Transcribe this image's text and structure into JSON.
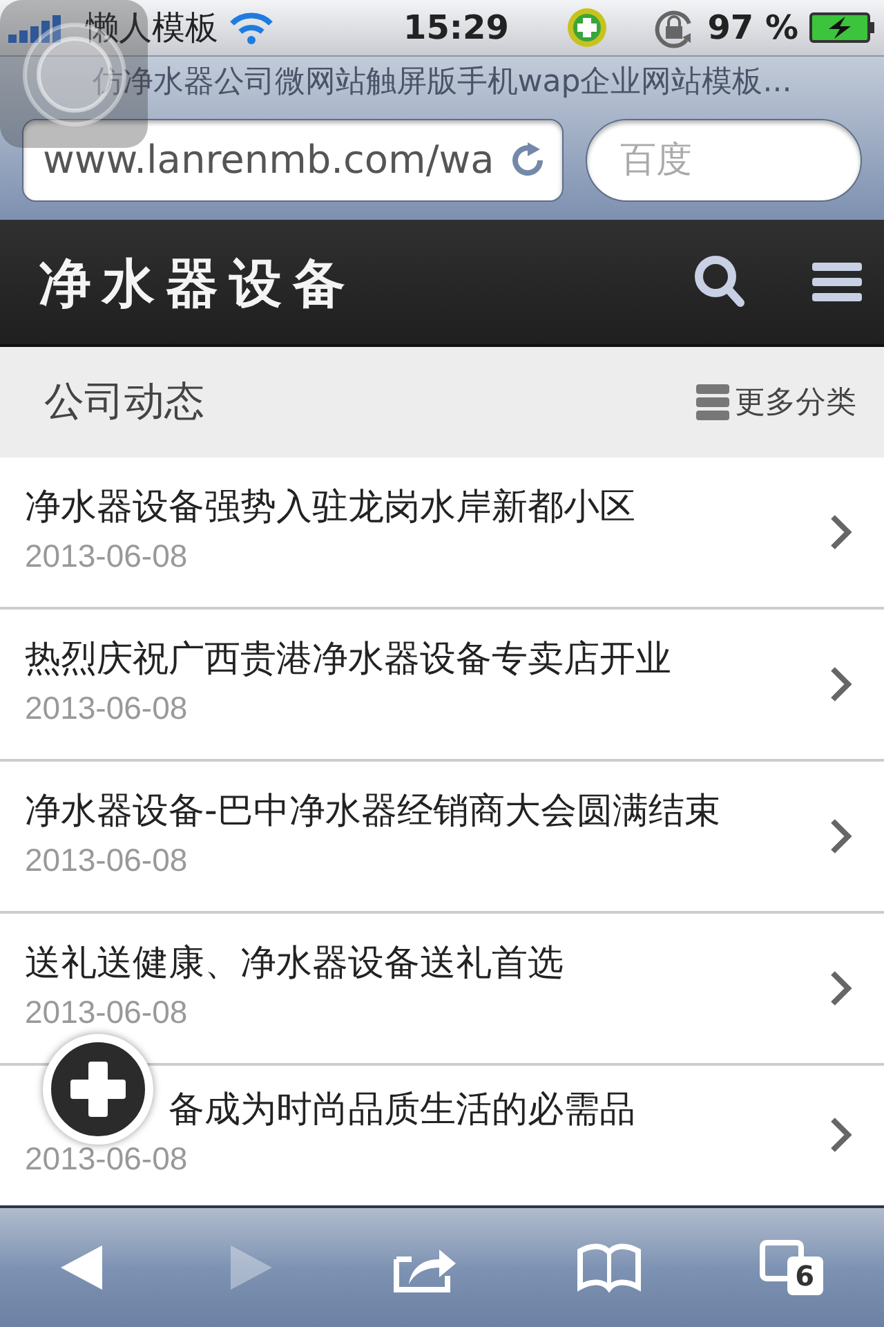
{
  "status_bar": {
    "carrier": "懒人模板",
    "time": "15:29",
    "battery": "97 %"
  },
  "browser": {
    "page_title": "仿净水器公司微网站触屏版手机wap企业网站模板...",
    "url": "www.lanrenmb.com/wa",
    "search": {
      "placeholder": "百度"
    }
  },
  "header": {
    "logo": "净水器设备"
  },
  "section": {
    "title": "公司动态",
    "more": "更多分类"
  },
  "news": [
    {
      "title": "净水器设备强势入驻龙岗水岸新都小区",
      "date": "2013-06-08"
    },
    {
      "title": "热烈庆祝广西贵港净水器设备专卖店开业",
      "date": "2013-06-08"
    },
    {
      "title": "净水器设备-巴中净水器经销商大会圆满结束",
      "date": "2013-06-08"
    },
    {
      "title": "送礼送健康、净水器设备送礼首选",
      "date": "2013-06-08"
    },
    {
      "title": "备成为时尚品质生活的必需品",
      "date": "2013-06-08"
    }
  ],
  "toolbar": [
    {
      "kind": "back",
      "disabled": false
    },
    {
      "kind": "forward",
      "disabled": true
    },
    {
      "kind": "share",
      "disabled": false
    },
    {
      "kind": "bookmarks",
      "disabled": false
    },
    {
      "kind": "tabs",
      "disabled": false,
      "count": "6"
    }
  ]
}
